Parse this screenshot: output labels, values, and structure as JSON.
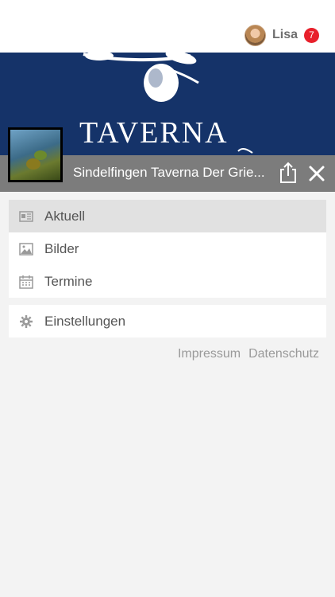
{
  "header": {
    "user_name": "Lisa",
    "notification_count": "7"
  },
  "banner": {
    "text": "TAVERNA"
  },
  "page": {
    "title": "Sindelfingen Taverna Der Grie..."
  },
  "menu": {
    "items": [
      {
        "label": "Aktuell",
        "icon": "news-icon",
        "active": true
      },
      {
        "label": "Bilder",
        "icon": "image-icon",
        "active": false
      },
      {
        "label": "Termine",
        "icon": "calendar-icon",
        "active": false
      }
    ]
  },
  "settings": {
    "label": "Einstellungen",
    "icon": "gear-icon"
  },
  "footer": {
    "impressum": "Impressum",
    "datenschutz": "Datenschutz"
  },
  "colors": {
    "banner": "#153369",
    "titlebar": "#7c7c7c",
    "badge": "#e8202b",
    "background": "#f3f3f3"
  }
}
